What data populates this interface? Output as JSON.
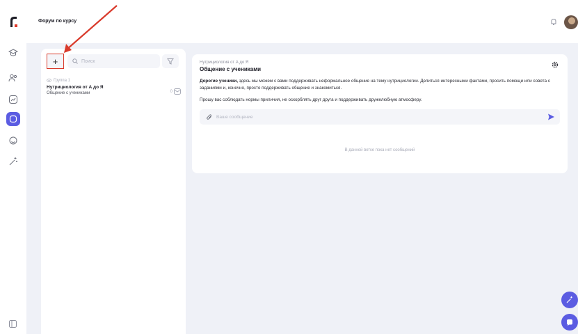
{
  "header": {
    "title": "Форум по курсу"
  },
  "list": {
    "add_label": "+",
    "search_placeholder": "Поиск",
    "chat": {
      "meta": "Группа 1",
      "name": "Нутрициология от А до Я",
      "subtitle": "Общение с учениками",
      "count": "0"
    }
  },
  "chat": {
    "breadcrumb": "Нутрициология от А до Я",
    "title": "Общение с учениками",
    "desc_bold": "Дорогие ученики,",
    "desc_text": " здесь мы можем с вами поддерживать неформальное общение на тему нутрициологии. Делиться интересными фактами, просить помощи или совета с заданиями и, конечно, просто поддерживать общение и знакомиться.",
    "rules": "Прошу вас соблюдать нормы приличия, не оскорблять друг друга и поддерживать дружелюбную атмосферу.",
    "message_placeholder": "Ваше сообщение",
    "empty": "В данной ветке пока нет сообщений"
  },
  "colors": {
    "accent": "#5b5ce2",
    "highlight": "#d93a2b",
    "background": "#eff1f7"
  },
  "icons": [
    "logo-icon",
    "graduation-cap-icon",
    "users-icon",
    "chart-icon",
    "chat-icon",
    "support-icon",
    "wand-icon",
    "bell-icon",
    "search-icon",
    "filter-icon",
    "eye-icon",
    "mail-icon",
    "settings-icon",
    "paperclip-icon",
    "send-icon",
    "sidebar-collapse-icon"
  ]
}
